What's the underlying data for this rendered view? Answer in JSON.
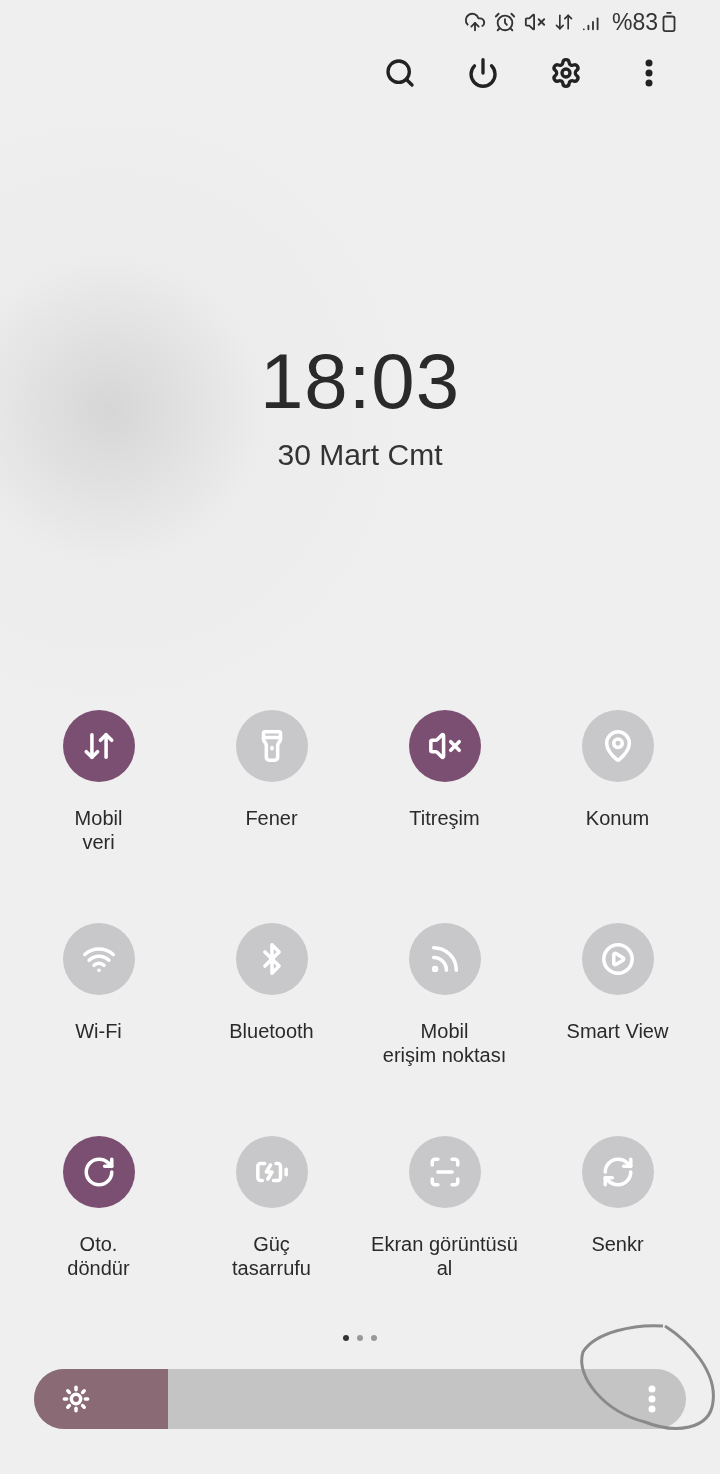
{
  "status_bar": {
    "battery": "%83"
  },
  "clock": {
    "time": "18:03",
    "date": "30 Mart Cmt"
  },
  "tiles": [
    {
      "kind": "mobile-data",
      "label": "Mobil\nveri",
      "on": true
    },
    {
      "kind": "flashlight",
      "label": "Fener",
      "on": false
    },
    {
      "kind": "vibrate",
      "label": "Titreşim",
      "on": true
    },
    {
      "kind": "location",
      "label": "Konum",
      "on": false
    },
    {
      "kind": "wifi",
      "label": "Wi-Fi",
      "on": false
    },
    {
      "kind": "bluetooth",
      "label": "Bluetooth",
      "on": false
    },
    {
      "kind": "hotspot",
      "label": "Mobil\nerişim noktası",
      "on": false
    },
    {
      "kind": "smart-view",
      "label": "Smart View",
      "on": false
    },
    {
      "kind": "rotate",
      "label": "Oto.\ndöndür",
      "on": true
    },
    {
      "kind": "power-saving",
      "label": "Güç\ntasarrufu",
      "on": false
    },
    {
      "kind": "screenshot",
      "label": "Ekran görüntüsü\nal",
      "on": false
    },
    {
      "kind": "sync",
      "label": "Senkr",
      "on": false
    }
  ],
  "pages": [
    {
      "selected": true
    },
    {
      "selected": false
    },
    {
      "selected": false
    }
  ],
  "brightness": {
    "level": 0.205
  }
}
